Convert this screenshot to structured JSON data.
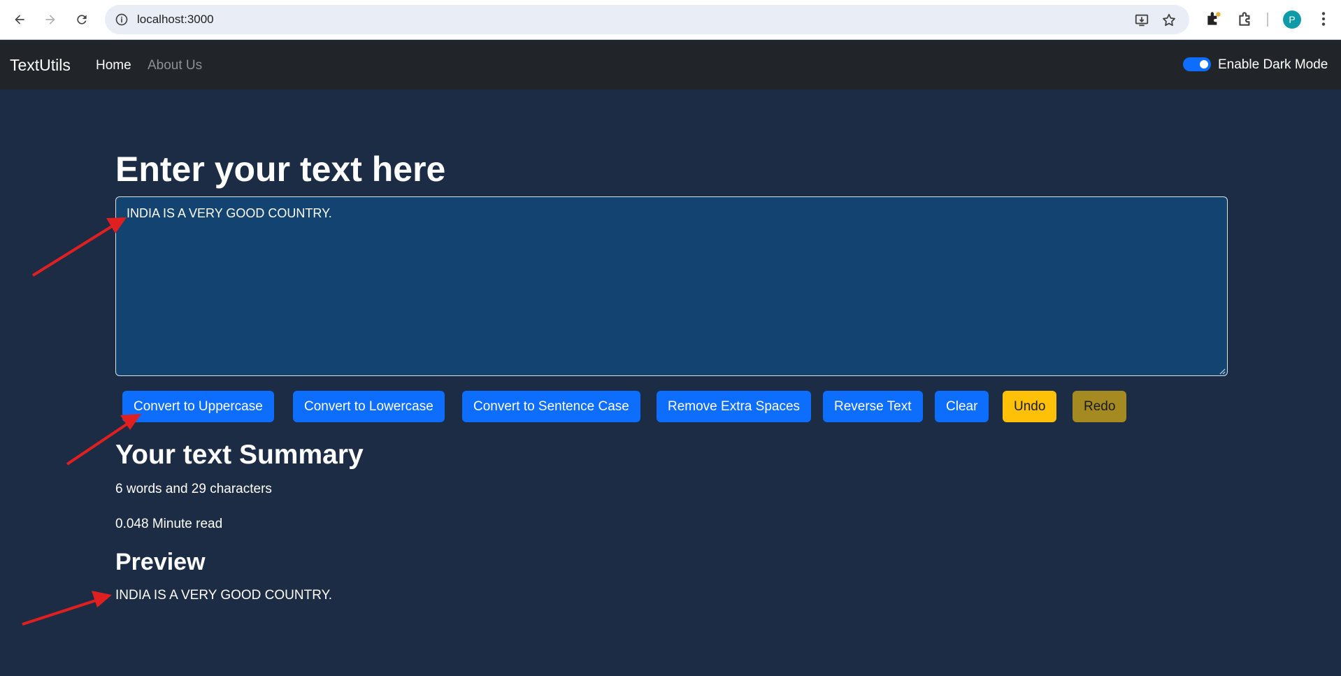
{
  "browser": {
    "url": "localhost:3000",
    "profile_initial": "P"
  },
  "navbar": {
    "brand": "TextUtils",
    "links": [
      "Home",
      "About Us"
    ],
    "dark_mode_label": "Enable Dark Mode",
    "dark_mode_enabled": true
  },
  "main": {
    "heading": "Enter your text here",
    "textarea_value": "INDIA IS A VERY GOOD COUNTRY.",
    "buttons": [
      "Convert to Uppercase",
      "Convert to Lowercase",
      "Convert to Sentence Case",
      "Remove Extra Spaces",
      "Reverse Text",
      "Clear",
      "Undo",
      "Redo"
    ]
  },
  "summary": {
    "heading": "Your text Summary",
    "counts": "6 words and 29 characters",
    "read_time": "0.048 Minute read"
  },
  "preview": {
    "heading": "Preview",
    "text": "INDIA IS A VERY GOOD COUNTRY."
  },
  "colors": {
    "background": "#1b2c44",
    "navbar": "#212529",
    "textarea": "#134370",
    "primary": "#0d6efd",
    "warning": "#ffc107",
    "annotation": "#e02020"
  }
}
